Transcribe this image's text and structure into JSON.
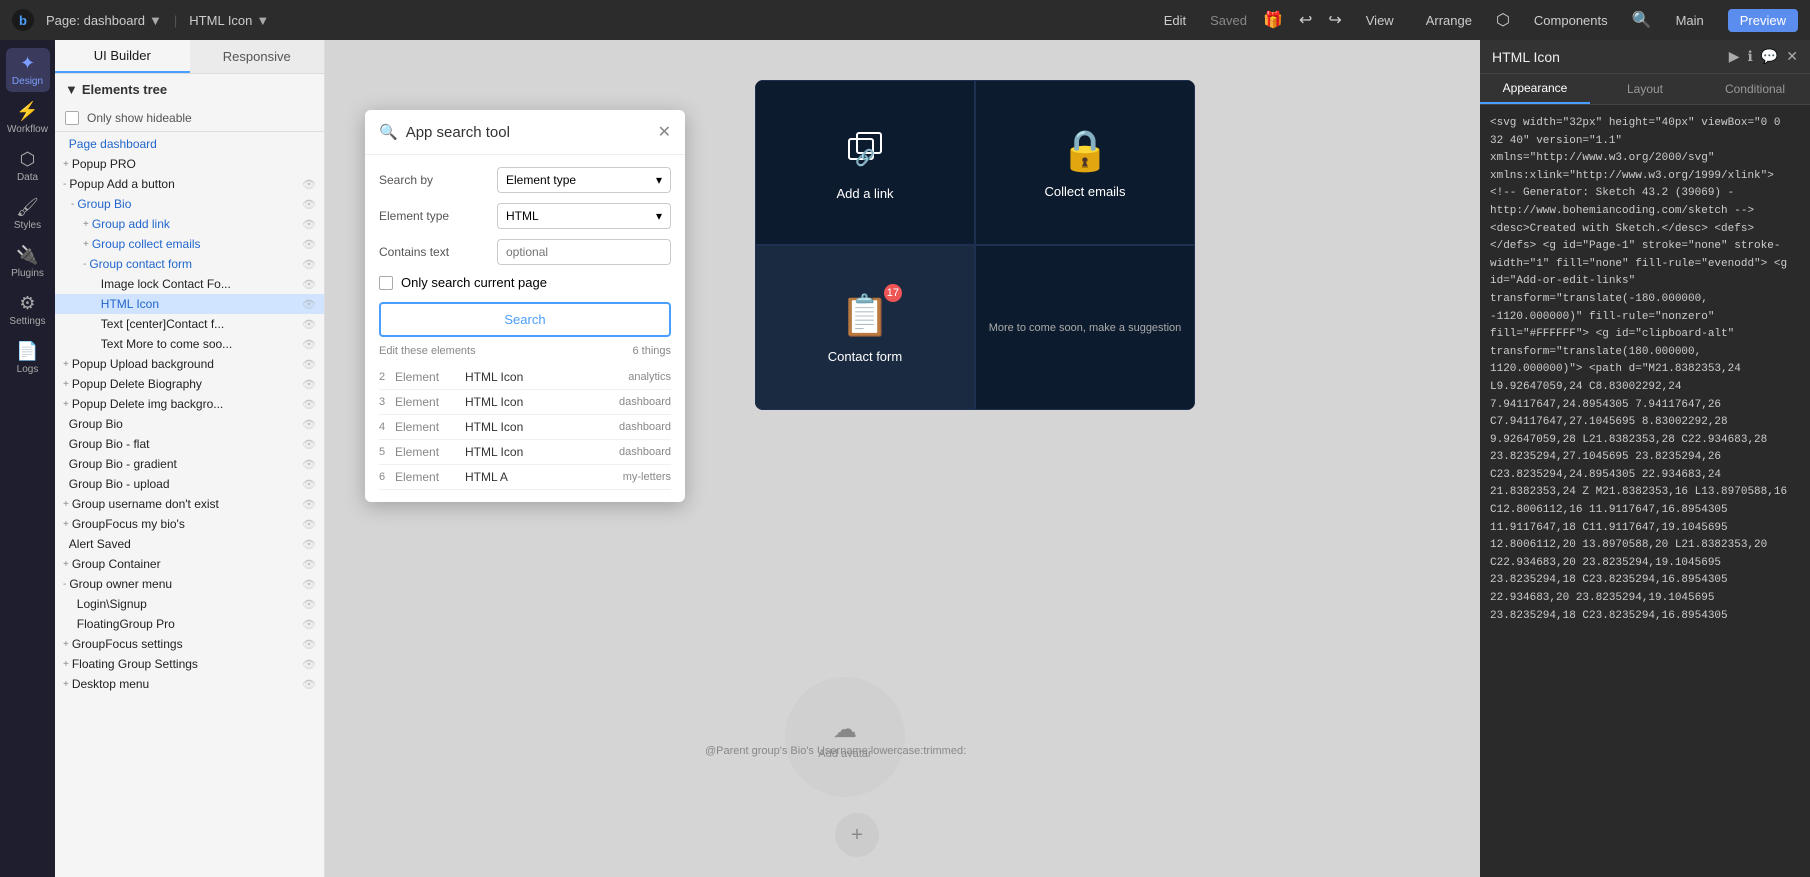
{
  "topbar": {
    "logo": "b",
    "page_label": "Page: dashboard",
    "element_label": "HTML Icon",
    "edit_label": "Edit",
    "saved_label": "Saved",
    "view_label": "View",
    "arrange_label": "Arrange",
    "components_label": "Components",
    "main_label": "Main",
    "preview_label": "Preview"
  },
  "panel": {
    "tab_ui": "UI Builder",
    "tab_responsive": "Responsive",
    "elements_header": "Elements tree",
    "only_hideable": "Only show hideable",
    "tree_items": [
      {
        "id": 1,
        "label": "Page dashboard",
        "indent": 0,
        "color": "blue",
        "expand": "",
        "has_eye": false
      },
      {
        "id": 2,
        "label": "Popup PRO",
        "indent": 0,
        "color": "dark",
        "expand": "+",
        "has_eye": false
      },
      {
        "id": 3,
        "label": "Popup Add a button",
        "indent": 0,
        "color": "dark",
        "expand": "-",
        "has_eye": true
      },
      {
        "id": 4,
        "label": "Group Bio",
        "indent": 1,
        "color": "blue",
        "expand": "-",
        "has_eye": true
      },
      {
        "id": 5,
        "label": "Group add link",
        "indent": 2,
        "color": "blue",
        "expand": "+",
        "has_eye": true
      },
      {
        "id": 6,
        "label": "Group collect emails",
        "indent": 2,
        "color": "blue",
        "expand": "+",
        "has_eye": true
      },
      {
        "id": 7,
        "label": "Group contact form",
        "indent": 2,
        "color": "blue",
        "expand": "-",
        "has_eye": true
      },
      {
        "id": 8,
        "label": "Image lock Contact Fo...",
        "indent": 3,
        "color": "dark",
        "expand": "",
        "has_eye": true
      },
      {
        "id": 9,
        "label": "HTML Icon",
        "indent": 3,
        "color": "blue",
        "expand": "",
        "has_eye": true,
        "selected": true
      },
      {
        "id": 10,
        "label": "Text [center]Contact f...",
        "indent": 3,
        "color": "dark",
        "expand": "",
        "has_eye": true
      },
      {
        "id": 11,
        "label": "Text More to come soo...",
        "indent": 3,
        "color": "dark",
        "expand": "",
        "has_eye": true
      },
      {
        "id": 12,
        "label": "Popup Upload background",
        "indent": 0,
        "color": "dark",
        "expand": "+",
        "has_eye": true
      },
      {
        "id": 13,
        "label": "Popup Delete Biography",
        "indent": 0,
        "color": "dark",
        "expand": "+",
        "has_eye": true
      },
      {
        "id": 14,
        "label": "Popup Delete img backgro...",
        "indent": 0,
        "color": "dark",
        "expand": "+",
        "has_eye": true
      },
      {
        "id": 15,
        "label": "Group Bio",
        "indent": 0,
        "color": "dark",
        "expand": "",
        "has_eye": true
      },
      {
        "id": 16,
        "label": "Group Bio - flat",
        "indent": 0,
        "color": "dark",
        "expand": "",
        "has_eye": true
      },
      {
        "id": 17,
        "label": "Group Bio - gradient",
        "indent": 0,
        "color": "dark",
        "expand": "",
        "has_eye": true
      },
      {
        "id": 18,
        "label": "Group Bio - upload",
        "indent": 0,
        "color": "dark",
        "expand": "",
        "has_eye": true
      },
      {
        "id": 19,
        "label": "Group username don't exist",
        "indent": 0,
        "color": "dark",
        "expand": "+",
        "has_eye": true
      },
      {
        "id": 20,
        "label": "GroupFocus my bio's",
        "indent": 0,
        "color": "dark",
        "expand": "+",
        "has_eye": true
      },
      {
        "id": 21,
        "label": "Alert Saved",
        "indent": 0,
        "color": "dark",
        "expand": "",
        "has_eye": true
      },
      {
        "id": 22,
        "label": "Group Container",
        "indent": 0,
        "color": "dark",
        "expand": "+",
        "has_eye": true
      },
      {
        "id": 23,
        "label": "Group owner menu",
        "indent": 0,
        "color": "dark",
        "expand": "-",
        "has_eye": true
      },
      {
        "id": 24,
        "label": "Login\\Signup",
        "indent": 1,
        "color": "dark",
        "expand": "",
        "has_eye": true
      },
      {
        "id": 25,
        "label": "FloatingGroup Pro",
        "indent": 1,
        "color": "dark",
        "expand": "",
        "has_eye": true
      },
      {
        "id": 26,
        "label": "GroupFocus settings",
        "indent": 0,
        "color": "dark",
        "expand": "+",
        "has_eye": true
      },
      {
        "id": 27,
        "label": "Floating Group Settings",
        "indent": 0,
        "color": "dark",
        "expand": "+",
        "has_eye": true
      },
      {
        "id": 28,
        "label": "Desktop menu",
        "indent": 0,
        "color": "dark",
        "expand": "+",
        "has_eye": true
      }
    ]
  },
  "search_dialog": {
    "title": "App search tool",
    "search_by_label": "Search by",
    "search_by_value": "Element type",
    "element_type_label": "Element type",
    "element_type_value": "HTML",
    "contains_text_label": "Contains text",
    "contains_text_placeholder": "optional",
    "only_current_page_label": "Only search current page",
    "search_button": "Search",
    "edit_these_label": "Edit these elements",
    "results_count": "6 things",
    "results": [
      {
        "num": "2",
        "type": "Element",
        "name": "HTML Icon",
        "page": "analytics"
      },
      {
        "num": "3",
        "type": "Element",
        "name": "HTML Icon",
        "page": "dashboard"
      },
      {
        "num": "4",
        "type": "Element",
        "name": "HTML Icon",
        "page": "dashboard"
      },
      {
        "num": "5",
        "type": "Element",
        "name": "HTML Icon",
        "page": "dashboard"
      },
      {
        "num": "6",
        "type": "Element",
        "name": "HTML A",
        "page": "my-letters"
      }
    ]
  },
  "canvas": {
    "cards": [
      {
        "icon": "🔗",
        "label": "Add a link"
      },
      {
        "icon": "🔒",
        "label": "Collect emails"
      },
      {
        "icon": "📋",
        "label": "Contact form"
      },
      {
        "icon": "more",
        "label": "More to come soon, make a suggestion"
      }
    ],
    "avatar_label": "Add avatar",
    "bottom_text": "@Parent group's Bio's Username:lowercase:trimmed:"
  },
  "right_panel": {
    "title": "HTML Icon",
    "tab_appearance": "Appearance",
    "tab_layout": "Layout",
    "tab_conditional": "Conditional",
    "code_content": "<svg width=\"32px\" height=\"40px\" viewBox=\"0 0 32 40\" version=\"1.1\"\nxmlns=\"http://www.w3.org/2000/svg\"\nxmlns:xlink=\"http://www.w3.org/1999/xlink\">\n    <!-- Generator: Sketch 43.2 (39069) -\n    http://www.bohemiancoding.com/sketch -->\n    <desc>Created with Sketch.</desc>\n    <defs></defs>\n    <g id=\"Page-1\" stroke=\"none\" stroke-width=\"1\"\n    fill=\"none\" fill-rule=\"evenodd\">\n        <g id=\"Add-or-edit-links\"\n        transform=\"translate(-180.000000, -1120.000000)\"\n        fill-rule=\"nonzero\" fill=\"#FFFFFF\">\n            <g id=\"clipboard-alt\"\n            transform=\"translate(180.000000, 1120.000000)\">\n                <path d=\"M21.8382353,24\nL9.92647059,24 C8.83002292,24\n7.94117647,24.8954305 7.94117647,26\nC7.94117647,27.1045695 8.83002292,28\n9.92647059,28 L21.8382353,28 C22.934683,28\n23.8235294,27.1045695 23.8235294,26\nC23.8235294,24.8954305 22.934683,24\n21.8382353,24 Z M21.8382353,16 L13.8970588,16\nC12.8006112,16 11.9117647,16.8954305\n11.9117647,18 C11.9117647,19.1045695\n12.8006112,20 13.8970588,20 L21.8382353,20\nC22.934683,20 23.8235294,19.1045695\n23.8235294,18 C23.8235294,16.8954305\n22.934683,20 23.8235294,19.1045695\n23.8235294,18 C23.8235294,16.8954305"
  },
  "sidebar_icons": [
    {
      "id": "design",
      "label": "Design",
      "icon": "✦",
      "active": true
    },
    {
      "id": "workflow",
      "label": "Workflow",
      "icon": "⚡"
    },
    {
      "id": "data",
      "label": "Data",
      "icon": "⬡"
    },
    {
      "id": "styles",
      "label": "Styles",
      "icon": "🖌"
    },
    {
      "id": "plugins",
      "label": "Plugins",
      "icon": "🔌"
    },
    {
      "id": "settings",
      "label": "Settings",
      "icon": "⚙"
    },
    {
      "id": "logs",
      "label": "Logs",
      "icon": "📄"
    }
  ]
}
